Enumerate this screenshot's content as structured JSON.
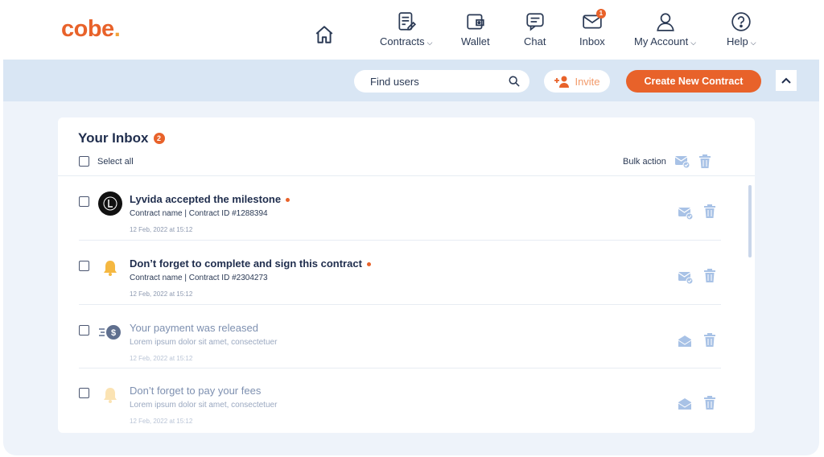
{
  "brand": {
    "logo_text": "cobe",
    "logo_dot": ".",
    "accent": "#e8622a"
  },
  "nav": {
    "items": [
      {
        "label": "",
        "icon": "home-icon"
      },
      {
        "label": "Contracts",
        "icon": "contracts-icon",
        "has_caret": true
      },
      {
        "label": "Wallet",
        "icon": "wallet-icon"
      },
      {
        "label": "Chat",
        "icon": "chat-icon"
      },
      {
        "label": "Inbox",
        "icon": "inbox-icon",
        "badge": "1"
      },
      {
        "label": "My Account",
        "icon": "user-icon",
        "has_caret": true
      },
      {
        "label": "Help",
        "icon": "help-icon",
        "has_caret": true
      }
    ]
  },
  "actionbar": {
    "search_placeholder": "Find users",
    "invite_label": "Invite",
    "create_label": "Create New Contract"
  },
  "inbox": {
    "title": "Your Inbox",
    "unread_count": "2",
    "select_all_label": "Select all",
    "bulk_action_label": "Bulk action",
    "messages": [
      {
        "title": "Lyvida accepted the milestone",
        "subtitle": "Contract name | Contract ID #1288394",
        "date": "12 Feb, 2022 at 15:12",
        "unread": true,
        "icon": "company-logo"
      },
      {
        "title": "Don’t forget to complete and sign this contract",
        "subtitle": "Contract name | Contract ID #2304273",
        "date": "12 Feb, 2022 at 15:12",
        "unread": true,
        "icon": "bell-icon"
      },
      {
        "title": "Your payment was released",
        "subtitle": "Lorem ipsum dolor sit amet, consectetuer",
        "date": "12 Feb, 2022 at 15:12",
        "unread": false,
        "icon": "payment-icon"
      },
      {
        "title": "Don’t forget to pay your fees",
        "subtitle": "Lorem ipsum dolor sit amet, consectetuer",
        "date": "12 Feb, 2022 at 15:12",
        "unread": false,
        "icon": "bell-icon"
      }
    ]
  }
}
